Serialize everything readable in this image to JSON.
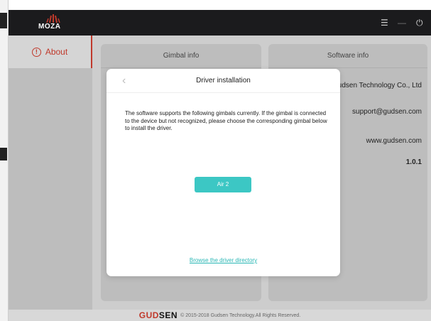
{
  "app": {
    "logo_text": "MOZA",
    "window_controls": [
      {
        "name": "menu-icon",
        "glyph": "☰"
      },
      {
        "name": "minimize-icon",
        "glyph": "—"
      },
      {
        "name": "power-icon",
        "glyph": "⏻"
      }
    ]
  },
  "sidebar": {
    "items": [
      {
        "label": "About",
        "icon": "info-circle-icon",
        "active": true
      }
    ]
  },
  "cards": {
    "gimbal_info": {
      "title": "Gimbal info"
    },
    "software_info": {
      "title": "Software info",
      "company": "udsen Technology Co., Ltd",
      "email": "support@gudsen.com",
      "website": "www.gudsen.com",
      "version": "1.0.1"
    }
  },
  "modal": {
    "title": "Driver installation",
    "description": "The software supports the following gimbals currently. If the gimbal is connected to the device but not recognized, please choose the corresponding gimbal below to install the driver.",
    "gimbal_button": "Air 2",
    "browse_link": "Browse the driver directory"
  },
  "footer": {
    "brand_a": "GUD",
    "brand_b": "SEN",
    "copyright": "© 2015-2018 Gudsen Technology.All Rights Reserved."
  },
  "colors": {
    "accent": "#c0392b",
    "teal": "#3cc7c4",
    "titlebar": "#1b1b1d"
  }
}
